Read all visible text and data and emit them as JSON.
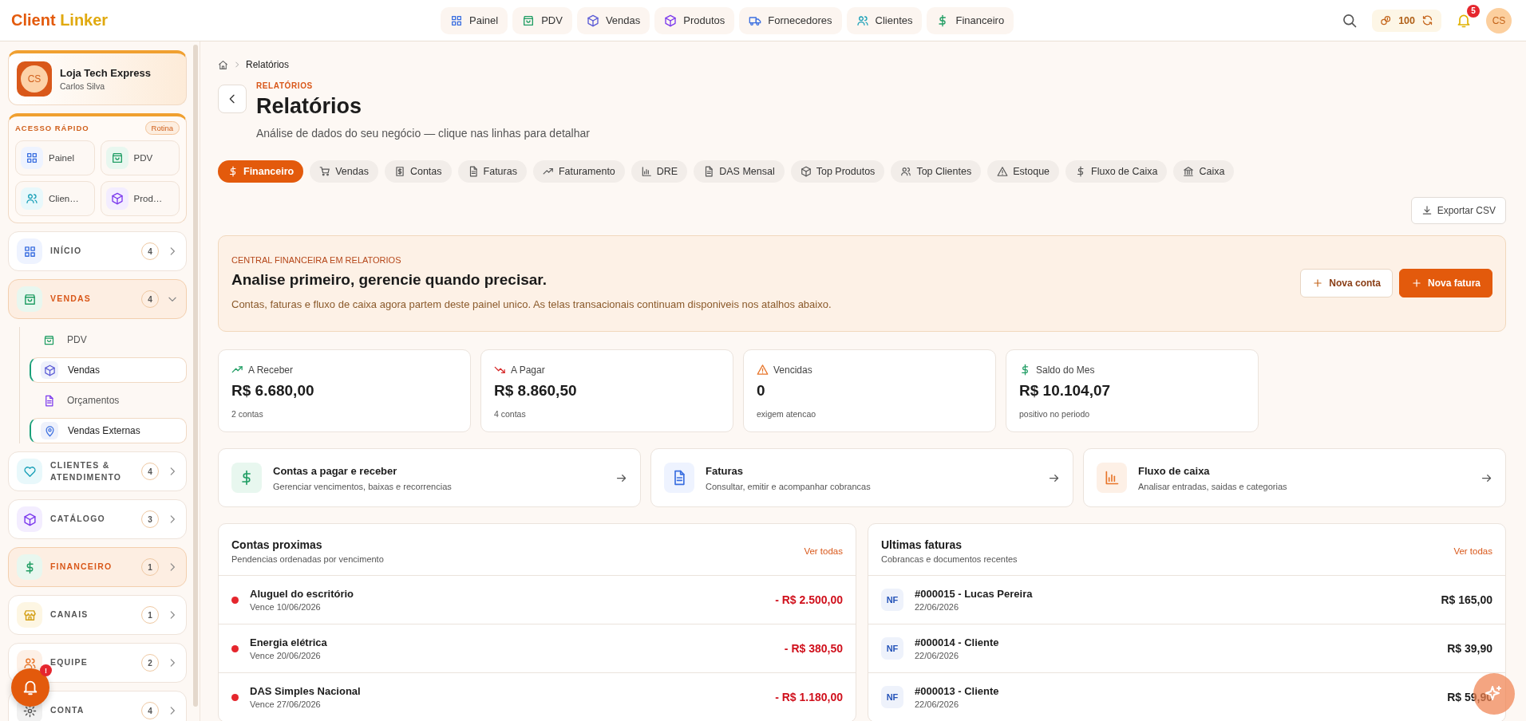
{
  "brand": {
    "first": "Client",
    "second": "Linker"
  },
  "top_nav": [
    {
      "label": "Painel"
    },
    {
      "label": "PDV"
    },
    {
      "label": "Vendas"
    },
    {
      "label": "Produtos"
    },
    {
      "label": "Fornecedores"
    },
    {
      "label": "Clientes"
    },
    {
      "label": "Financeiro"
    }
  ],
  "coins": "100",
  "notifications": "5",
  "avatar": "CS",
  "sidebar": {
    "store": {
      "initials": "CS",
      "name": "Loja Tech Express",
      "owner": "Carlos Silva"
    },
    "quick_access": {
      "title": "ACESSO RÁPIDO",
      "badge": "Rotina",
      "items": [
        {
          "label": "Painel"
        },
        {
          "label": "PDV"
        },
        {
          "label": "Clien…"
        },
        {
          "label": "Prod…"
        }
      ]
    },
    "groups": [
      {
        "label": "INÍCIO",
        "count": "4",
        "expanded": false,
        "highlighted": false
      },
      {
        "label": "VENDAS",
        "count": "4",
        "expanded": true,
        "highlighted": true,
        "children": [
          {
            "label": "PDV",
            "highlighted": false
          },
          {
            "label": "Vendas",
            "highlighted": true
          },
          {
            "label": "Orçamentos",
            "highlighted": false
          },
          {
            "label": "Vendas Externas",
            "highlighted": true
          }
        ]
      },
      {
        "label": "CLIENTES & ATENDIMENTO",
        "count": "4",
        "expanded": false,
        "highlighted": false
      },
      {
        "label": "CATÁLOGO",
        "count": "3",
        "expanded": false,
        "highlighted": false
      },
      {
        "label": "FINANCEIRO",
        "count": "1",
        "expanded": false,
        "highlighted": true
      },
      {
        "label": "CANAIS",
        "count": "1",
        "expanded": false,
        "highlighted": false
      },
      {
        "label": "EQUIPE",
        "count": "2",
        "expanded": false,
        "highlighted": false
      },
      {
        "label": "CONTA",
        "count": "4",
        "expanded": false,
        "highlighted": false
      }
    ]
  },
  "floating_alert": "!",
  "breadcrumb": "Relatórios",
  "page": {
    "eyebrow": "RELATÓRIOS",
    "title": "Relatórios",
    "subtitle": "Análise de dados do seu negócio — clique nas linhas para detalhar"
  },
  "tabs": [
    {
      "label": "Financeiro",
      "selected": true
    },
    {
      "label": "Vendas",
      "selected": false
    },
    {
      "label": "Contas",
      "selected": false
    },
    {
      "label": "Faturas",
      "selected": false
    },
    {
      "label": "Faturamento",
      "selected": false
    },
    {
      "label": "DRE",
      "selected": false
    },
    {
      "label": "DAS Mensal",
      "selected": false
    },
    {
      "label": "Top Produtos",
      "selected": false
    },
    {
      "label": "Top Clientes",
      "selected": false
    },
    {
      "label": "Estoque",
      "selected": false
    },
    {
      "label": "Fluxo de Caixa",
      "selected": false
    },
    {
      "label": "Caixa",
      "selected": false
    }
  ],
  "export_button": "Exportar CSV",
  "banner": {
    "eyebrow": "CENTRAL FINANCEIRA EM RELATORIOS",
    "title": "Analise primeiro, gerencie quando precisar.",
    "text": "Contas, faturas e fluxo de caixa agora partem deste painel unico. As telas transacionais continuam disponiveis nos atalhos abaixo.",
    "buttons": [
      {
        "label": "Nova conta",
        "primary": false
      },
      {
        "label": "Nova fatura",
        "primary": true
      }
    ]
  },
  "stats": [
    {
      "label": "A Receber",
      "value": "R$ 6.680,00",
      "note": "2 contas"
    },
    {
      "label": "A Pagar",
      "value": "R$ 8.860,50",
      "note": "4 contas"
    },
    {
      "label": "Vencidas",
      "value": "0",
      "note": "exigem atencao"
    },
    {
      "label": "Saldo do Mes",
      "value": "R$ 10.104,07",
      "note": "positivo no periodo"
    }
  ],
  "shortcuts": [
    {
      "title": "Contas a pagar e receber",
      "desc": "Gerenciar vencimentos, baixas e recorrencias"
    },
    {
      "title": "Faturas",
      "desc": "Consultar, emitir e acompanhar cobrancas"
    },
    {
      "title": "Fluxo de caixa",
      "desc": "Analisar entradas, saidas e categorias"
    }
  ],
  "upcoming": {
    "title": "Contas proximas",
    "subtitle": "Pendencias ordenadas por vencimento",
    "link": "Ver todas",
    "rows": [
      {
        "name": "Aluguel do escritório",
        "due": "Vence 10/06/2026",
        "amount": "- R$ 2.500,00",
        "color": "#e5262d"
      },
      {
        "name": "Energia elétrica",
        "due": "Vence 20/06/2026",
        "amount": "- R$ 380,50",
        "color": "#e5262d"
      },
      {
        "name": "DAS Simples Nacional",
        "due": "Vence 27/06/2026",
        "amount": "- R$ 1.180,00",
        "color": "#e5262d"
      }
    ]
  },
  "invoices": {
    "title": "Ultimas faturas",
    "subtitle": "Cobrancas e documentos recentes",
    "link": "Ver todas",
    "rows": [
      {
        "badge": "NF",
        "title": "#000015 - Lucas Pereira",
        "date": "22/06/2026",
        "amount": "R$ 165,00"
      },
      {
        "badge": "NF",
        "title": "#000014 - Cliente",
        "date": "22/06/2026",
        "amount": "R$ 39,90"
      },
      {
        "badge": "NF",
        "title": "#000013 - Cliente",
        "date": "22/06/2026",
        "amount": "R$ 59,90"
      }
    ]
  }
}
